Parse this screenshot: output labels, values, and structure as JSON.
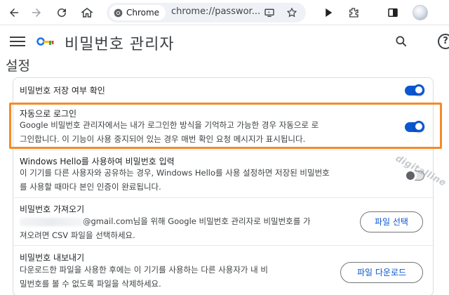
{
  "browser": {
    "chip_label": "Chrome",
    "url": "chrome://passwor...",
    "icons": [
      "back-arrow-icon",
      "forward-arrow-icon",
      "reload-icon",
      "home-icon",
      "chrome-logo-icon",
      "cast-icon",
      "star-icon",
      "play-icon",
      "extensions-icon",
      "side-panel-icon",
      "profile-avatar"
    ]
  },
  "header": {
    "title": "비밀번호 관리자",
    "icons": [
      "menu-icon",
      "key-icon",
      "search-icon",
      "help-icon"
    ],
    "help_glyph": "?"
  },
  "section": {
    "heading": "설정"
  },
  "settings": {
    "offer_save": {
      "title": "비밀번호 저장 여부 확인",
      "enabled": true
    },
    "auto_signin": {
      "title": "자동으로 로그인",
      "desc_line1": "Google 비밀번호 관리자에서는 내가 로그인한 방식을 기억하고 가능한 경우 자동으로 로",
      "desc_line2": "그인합니다. 이 기능이 사용 중지되어 있는 경우 매번 확인 요청 메시지가 표시됩니다.",
      "enabled": true
    },
    "windows_hello": {
      "title": "Windows Hello를 사용하여 비밀번호 입력",
      "desc_line1": "이 기기를 다른 사용자와 공유하는 경우, Windows Hello를 사용 설정하면 저장된 비밀번호",
      "desc_line2": "를 사용할 때마다 본인 인증이 완료됩니다.",
      "enabled": false
    },
    "import": {
      "title": "비밀번호 가져오기",
      "desc_line1_suffix": "@gmail.com님을 위해 Google 비밀번호 관리자로 비밀번호를 가",
      "desc_line2": "져오려면 CSV 파일을 선택하세요.",
      "button_label": "파일 선택"
    },
    "export": {
      "title": "비밀번호 내보내기",
      "desc_line1": "다운로드한 파일을 사용한 후에는 이 기기를 사용하는 다른 사용자가 내 비",
      "desc_line2": "밀번호를 볼 수 없도록 파일을 삭제하세요.",
      "button_label": "파일 다운로드"
    }
  },
  "colors": {
    "accent": "#0b57d0",
    "highlight_border": "#f28c28"
  },
  "watermark_text": "digitalline"
}
